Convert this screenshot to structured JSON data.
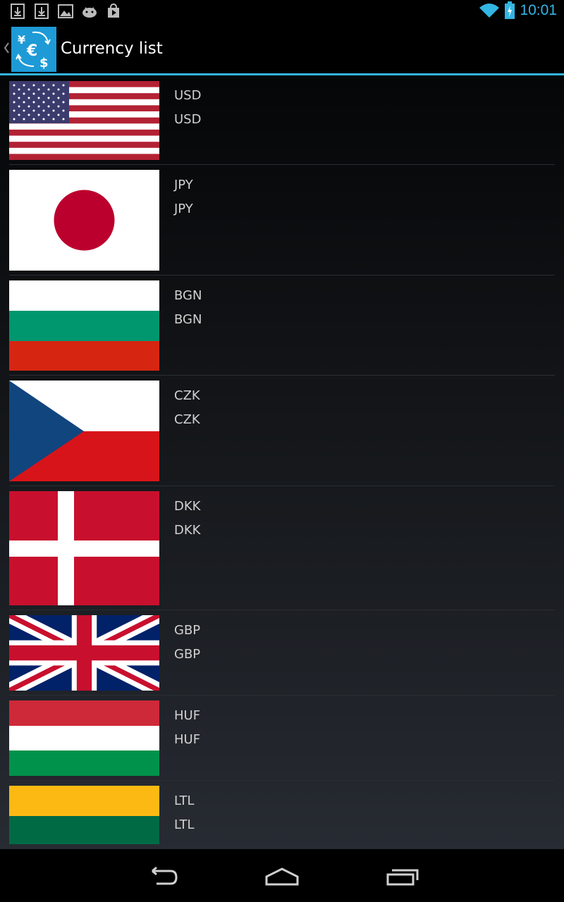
{
  "status_bar": {
    "time": "10:01",
    "notification_icons": [
      "download-icon",
      "download-icon",
      "image-icon",
      "android-icon",
      "play-store-icon"
    ],
    "wifi_icon": "wifi-icon",
    "battery_icon": "battery-charging-icon",
    "accent_color": "#33b5e5"
  },
  "action_bar": {
    "title": "Currency list",
    "app_icon": "currency-exchange-icon",
    "up_icon": "chevron-left-icon"
  },
  "currencies": [
    {
      "code": "USD",
      "name": "USD",
      "flag": "us-flag"
    },
    {
      "code": "JPY",
      "name": "JPY",
      "flag": "japan-flag"
    },
    {
      "code": "BGN",
      "name": "BGN",
      "flag": "bulgaria-flag"
    },
    {
      "code": "CZK",
      "name": "CZK",
      "flag": "czech-flag"
    },
    {
      "code": "DKK",
      "name": "DKK",
      "flag": "denmark-flag"
    },
    {
      "code": "GBP",
      "name": "GBP",
      "flag": "uk-flag"
    },
    {
      "code": "HUF",
      "name": "HUF",
      "flag": "hungary-flag"
    },
    {
      "code": "LTL",
      "name": "LTL",
      "flag": "lithuania-flag"
    }
  ],
  "nav_bar": {
    "back_icon": "back-icon",
    "home_icon": "home-icon",
    "recents_icon": "recent-apps-icon"
  }
}
